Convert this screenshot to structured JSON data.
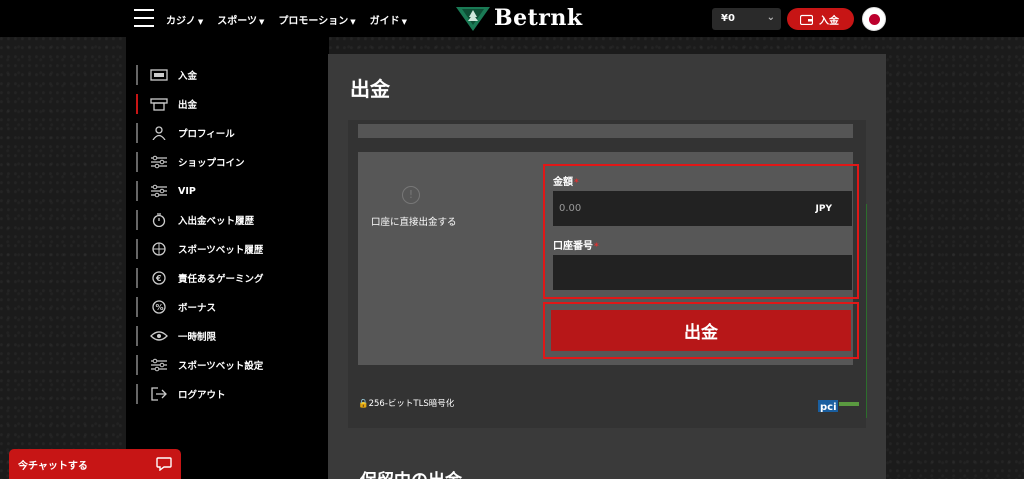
{
  "header": {
    "nav": [
      "カジノ",
      "スポーツ",
      "プロモーション",
      "ガイド"
    ],
    "logo_text": "Betrnk",
    "balance": "¥0",
    "deposit_label": "入金"
  },
  "sidebar": {
    "items": [
      {
        "label": "入金",
        "icon": "cash-icon"
      },
      {
        "label": "出金",
        "icon": "atm-icon"
      },
      {
        "label": "プロフィール",
        "icon": "user-icon"
      },
      {
        "label": "ショップコイン",
        "icon": "sliders-icon"
      },
      {
        "label": "VIP",
        "icon": "sliders-icon"
      },
      {
        "label": "入出金ベット履歴",
        "icon": "timer-icon"
      },
      {
        "label": "スポーツベット履歴",
        "icon": "ball-icon"
      },
      {
        "label": "責任あるゲーミング",
        "icon": "coin-icon"
      },
      {
        "label": "ボーナス",
        "icon": "percent-icon"
      },
      {
        "label": "一時制限",
        "icon": "eye-icon"
      },
      {
        "label": "スポーツベット設定",
        "icon": "sliders-icon"
      },
      {
        "label": "ログアウト",
        "icon": "logout-icon"
      }
    ]
  },
  "main": {
    "title": "出金",
    "method_label": "口座に直接出金する",
    "amount_label": "金額",
    "amount_placeholder": "0.00",
    "currency": "JPY",
    "account_label": "口座番号",
    "required_mark": "*",
    "submit_label": "出金",
    "security_text": "256-ビットTLS暗号化",
    "pending_title": "保留中の出金"
  },
  "chat": {
    "label": "今チャットする"
  },
  "colors": {
    "accent": "#c71515",
    "highlight": "#e01818",
    "panel": "#3a3a3a"
  }
}
